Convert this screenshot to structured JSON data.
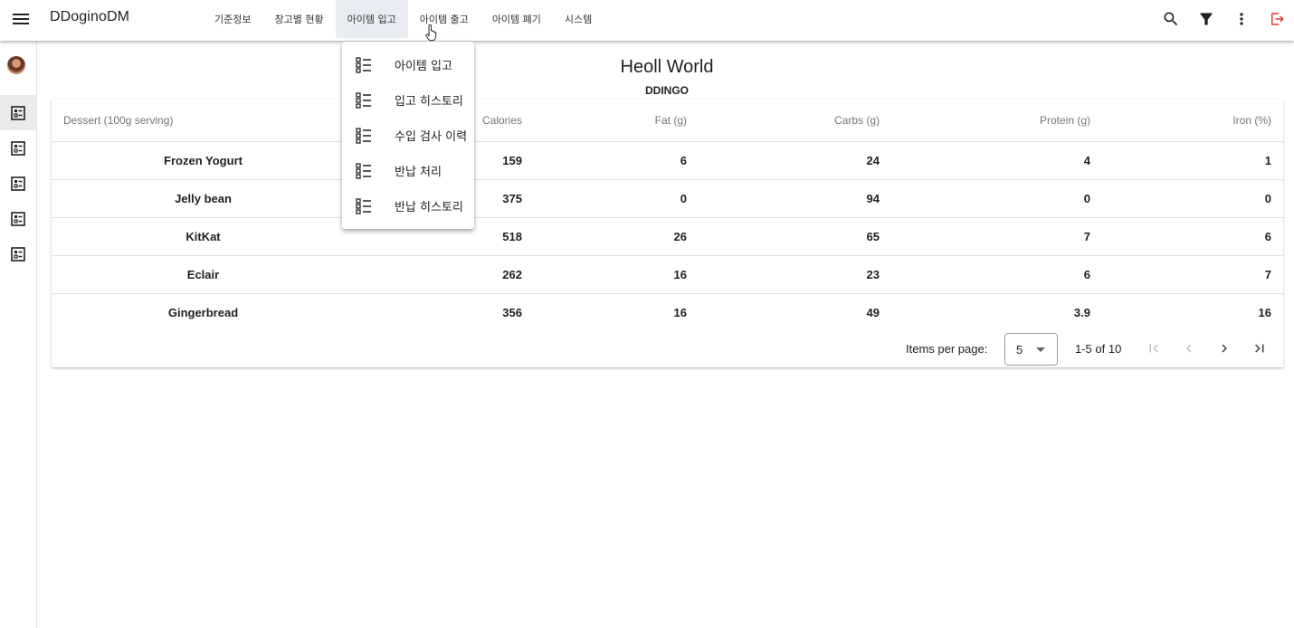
{
  "app": {
    "title": "DDoginoDM"
  },
  "toolbar": {
    "icons": [
      "menu-icon",
      "search-icon",
      "filter-icon",
      "more-vert-icon",
      "logout-icon"
    ],
    "logout_color": "#e53935"
  },
  "nav": {
    "items": [
      {
        "label": "기준정보"
      },
      {
        "label": "창고별 현황"
      },
      {
        "label": "아이템 입고",
        "active": true
      },
      {
        "label": "아이템 출고"
      },
      {
        "label": "아이템 폐기"
      },
      {
        "label": "시스템"
      }
    ]
  },
  "sidebar": {
    "items": [
      {
        "icon": "checklist-icon",
        "active": true
      },
      {
        "icon": "checklist-icon"
      },
      {
        "icon": "checklist-icon"
      },
      {
        "icon": "checklist-icon"
      },
      {
        "icon": "checklist-icon"
      }
    ]
  },
  "page": {
    "title": "Heoll World",
    "subtitle": "DDINGO"
  },
  "table": {
    "headers": {
      "dessert": "Dessert (100g serving)",
      "calories": "Calories",
      "fat": "Fat (g)",
      "carbs": "Carbs (g)",
      "protein": "Protein (g)",
      "iron": "Iron (%)"
    },
    "rows": [
      {
        "dessert": "Frozen Yogurt",
        "calories": "159",
        "fat": "6",
        "carbs": "24",
        "protein": "4",
        "iron": "1"
      },
      {
        "dessert": "Jelly bean",
        "calories": "375",
        "fat": "0",
        "carbs": "94",
        "protein": "0",
        "iron": "0"
      },
      {
        "dessert": "KitKat",
        "calories": "518",
        "fat": "26",
        "carbs": "65",
        "protein": "7",
        "iron": "6"
      },
      {
        "dessert": "Eclair",
        "calories": "262",
        "fat": "16",
        "carbs": "23",
        "protein": "6",
        "iron": "7"
      },
      {
        "dessert": "Gingerbread",
        "calories": "356",
        "fat": "16",
        "carbs": "49",
        "protein": "3.9",
        "iron": "16"
      }
    ]
  },
  "paginator": {
    "items_per_page_label": "Items per page:",
    "page_size": "5",
    "range_label": "1-5 of 10"
  },
  "dropdown": {
    "items": [
      {
        "label": "아이템 입고",
        "icon": "checklist-icon"
      },
      {
        "label": "입고 히스토리",
        "icon": "checklist-icon"
      },
      {
        "label": "수입 검사 이력",
        "icon": "checklist-icon"
      },
      {
        "label": "반납 처리",
        "icon": "checklist-icon"
      },
      {
        "label": "반납 히스토리",
        "icon": "checklist-icon"
      }
    ]
  }
}
